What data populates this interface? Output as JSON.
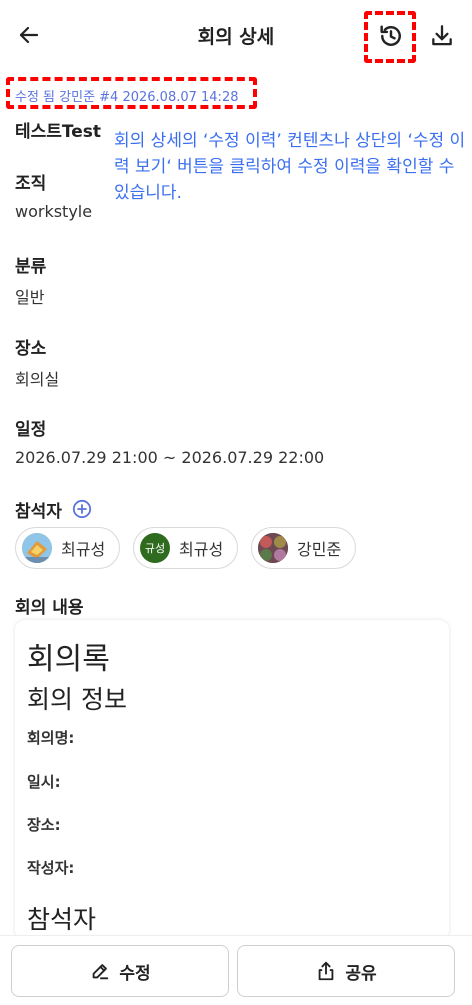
{
  "header": {
    "title": "회의 상세",
    "back_icon": "arrow-left-icon",
    "history_icon": "history-icon",
    "download_icon": "download-icon"
  },
  "edit_history_link": "수정 됨 강민준 #4 2026.08.07 14:28",
  "annotation": "회의 상세의 ‘수정 이력’ 컨텐츠나 상단의 ‘수정 이력 보기‘ 버튼을 클릭하여 수정 이력을 확인할 수 있습니다.",
  "meeting": {
    "name": "테스트Test",
    "org_label": "조직",
    "org_value": "workstyle",
    "category_label": "분류",
    "category_value": "일반",
    "place_label": "장소",
    "place_value": "회의실",
    "schedule_label": "일정",
    "schedule_value": "2026.07.29 21:00 ~ 2026.07.29 22:00",
    "attendees_label": "참석자"
  },
  "attendees": [
    {
      "name": "최규성",
      "avatar": "photo"
    },
    {
      "name": "최규성",
      "avatar": "initials",
      "initials": "규성",
      "color": "#2e6b1f"
    },
    {
      "name": "강민준",
      "avatar": "photo"
    }
  ],
  "content": {
    "label": "회의 내용",
    "h1": "회의록",
    "h2": "회의 정보",
    "items": [
      "회의명:",
      "일시:",
      "장소:",
      "작성자:"
    ],
    "h2b": "참석자"
  },
  "footer": {
    "edit_label": "수정",
    "share_label": "공유"
  },
  "colors": {
    "accent": "#5b73dd",
    "annotation": "#3b6ff0",
    "highlight": "#ff0000"
  }
}
